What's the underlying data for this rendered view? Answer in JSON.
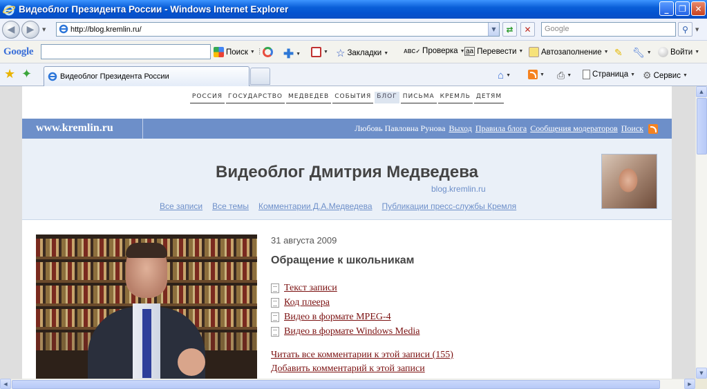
{
  "window": {
    "title": "Видеоблог Президента России - Windows Internet Explorer",
    "minimize": "_",
    "maximize": "❐",
    "close": "✕"
  },
  "address_bar": {
    "url": "http://blog.kremlin.ru/",
    "search_placeholder": "Google"
  },
  "google_toolbar": {
    "logo": "Google",
    "items": [
      {
        "label": "Поиск",
        "icon": "google-search-icon"
      },
      {
        "label": "Закладки",
        "icon": "star-icon"
      },
      {
        "label": "Проверка",
        "icon": "spellcheck-icon"
      },
      {
        "label": "Перевести",
        "icon": "translate-icon"
      },
      {
        "label": "Автозаполнение",
        "icon": "autofill-icon"
      },
      {
        "label": "Войти",
        "icon": "user-icon"
      }
    ]
  },
  "tabs": {
    "active_tab": "Видеоблог Президента России",
    "commands": [
      {
        "label": "Страница",
        "icon": "page-icon"
      },
      {
        "label": "Сервис",
        "icon": "gear-icon"
      }
    ]
  },
  "page": {
    "topnav": [
      "РОССИЯ",
      "ГОСУДАРСТВО",
      "МЕДВЕДЕВ",
      "СОБЫТИЯ",
      "БЛОГ",
      "ПИСЬМА",
      "КРЕМЛЬ",
      "ДЕТЯМ"
    ],
    "topnav_active": "БЛОГ",
    "site_name": "www.kremlin.ru",
    "user_name": "Любовь Павловна Рунова",
    "user_links": [
      "Выход",
      "Правила блога",
      "Сообщения модераторов",
      "Поиск"
    ],
    "header": {
      "title": "Видеоблог Дмитрия Медведева",
      "subtitle": "blog.kremlin.ru",
      "links": [
        "Все записи",
        "Все темы",
        "Комментарии Д.А.Медведева",
        "Публикации пресс-службы Кремля"
      ]
    },
    "post": {
      "date": "31 августа 2009",
      "title": "Обращение к школьникам",
      "files": [
        "Текст записи",
        "Код плеера",
        "Видео в формате MPEG-4",
        "Видео в формате Windows Media"
      ],
      "read_comments": "Читать все комментарии к этой записи (155)",
      "add_comment": "Добавить комментарий к этой записи"
    }
  },
  "colors": {
    "titlebar": "#0a5fd8",
    "site_blue": "#6d8fc9",
    "header_bg": "#eaf0f8",
    "link_dark_red": "#7a0f0f"
  }
}
